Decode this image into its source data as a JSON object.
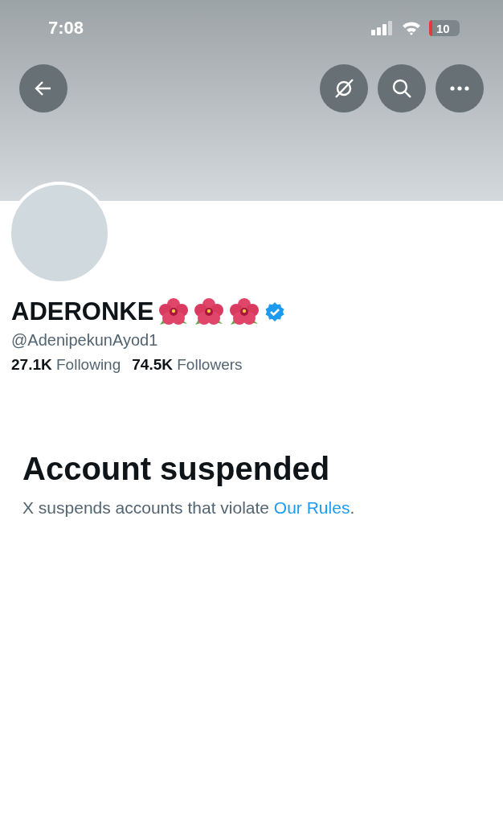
{
  "status_bar": {
    "time": "7:08",
    "battery": "10"
  },
  "profile": {
    "name": "ADERONKE",
    "verified": true,
    "handle": "@AdenipekunAyod1",
    "stats": [
      {
        "text": "**27.1K** Following"
      },
      {
        "text": "**74.5K** Followers"
      }
    ]
  },
  "notice": {
    "title": "Account suspended",
    "text": "X suspends accounts that violate ",
    "link": "Our Rules",
    "after": "."
  }
}
